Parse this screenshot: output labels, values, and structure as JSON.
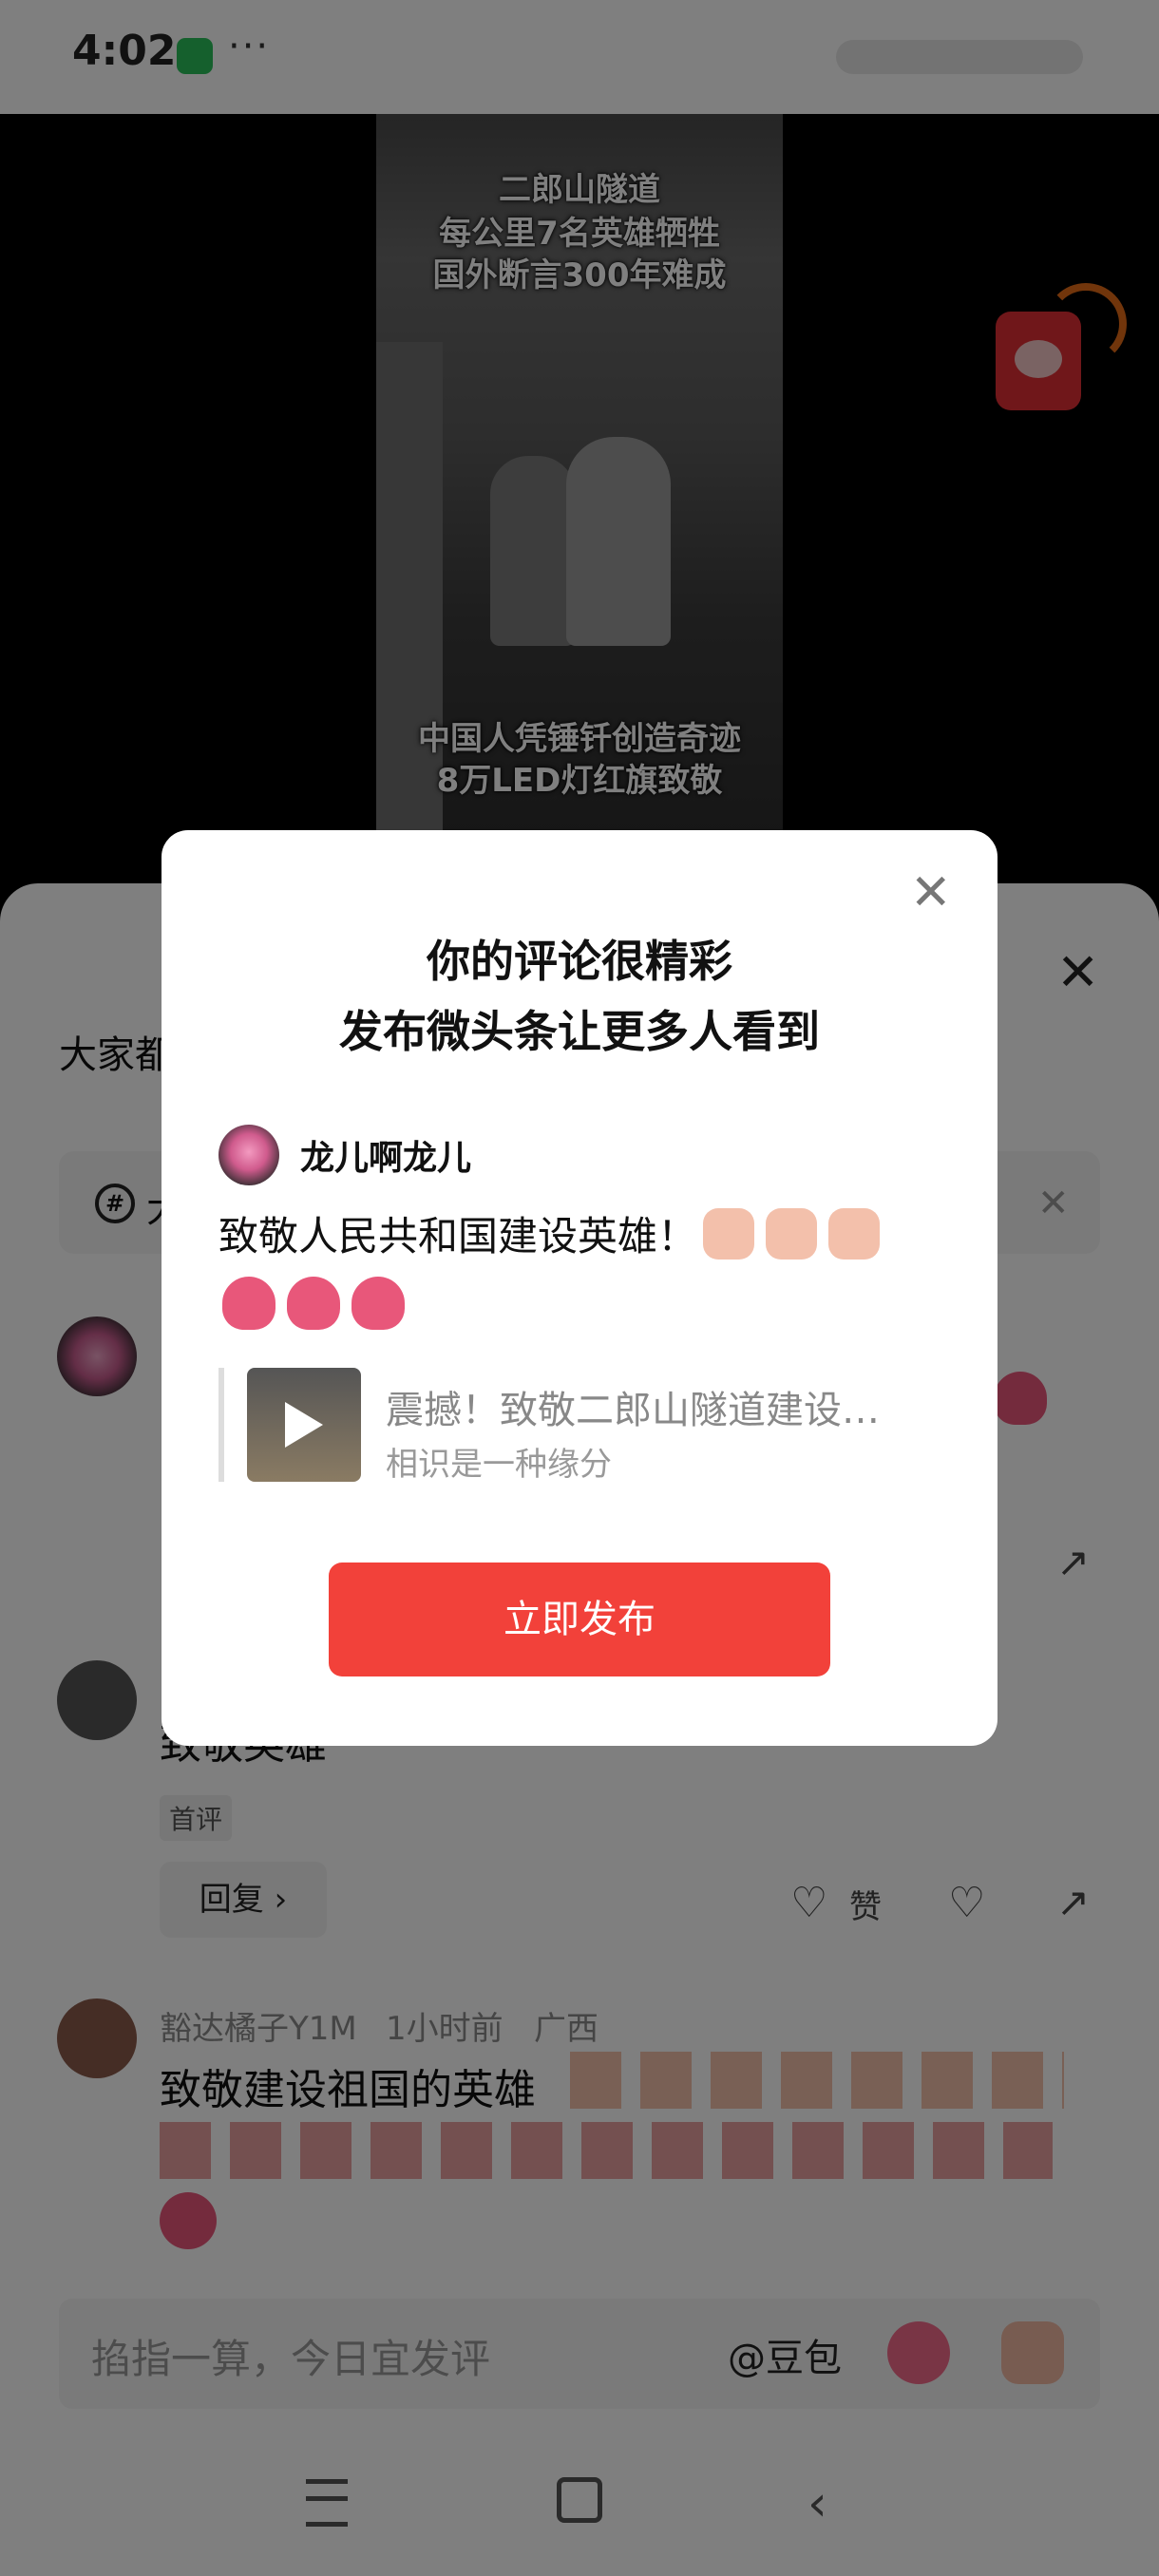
{
  "status_bar": {
    "time": "4:02",
    "more": "···"
  },
  "video": {
    "title_lines": [
      "二郎山隧道",
      "每公里7名英雄牺牲",
      "国外断言300年难成"
    ],
    "caption_lines": [
      "中国人凭锤钎创造奇迹",
      "8万LED灯红旗致敬"
    ]
  },
  "sheet": {
    "title_partial": "大家都",
    "topic_hash": "#",
    "topic_partial": "大"
  },
  "comments": [
    {
      "text_partial": "致敬英雄",
      "tag": "首评",
      "reply_label": "回复 ›",
      "like_label": "赞"
    },
    {
      "username": "豁达橘子Y1M",
      "time": "1小时前",
      "location": "广西",
      "text": "致敬建设祖国的英雄"
    }
  ],
  "composer": {
    "placeholder": "掐指一算，今日宜发评",
    "mention": "@豆包"
  },
  "dialog": {
    "title_line1": "你的评论很精彩",
    "title_line2": "发布微头条让更多人看到",
    "username": "龙儿啊龙儿",
    "comment_text": "致敬人民共和国建设英雄！",
    "quote_title": "震撼！致敬二郎山隧道建设…",
    "quote_source": "相识是一种缘分",
    "publish_label": "立即发布"
  },
  "colors": {
    "accent_red": "#f2413a",
    "wechat_green": "#2bc15a"
  }
}
